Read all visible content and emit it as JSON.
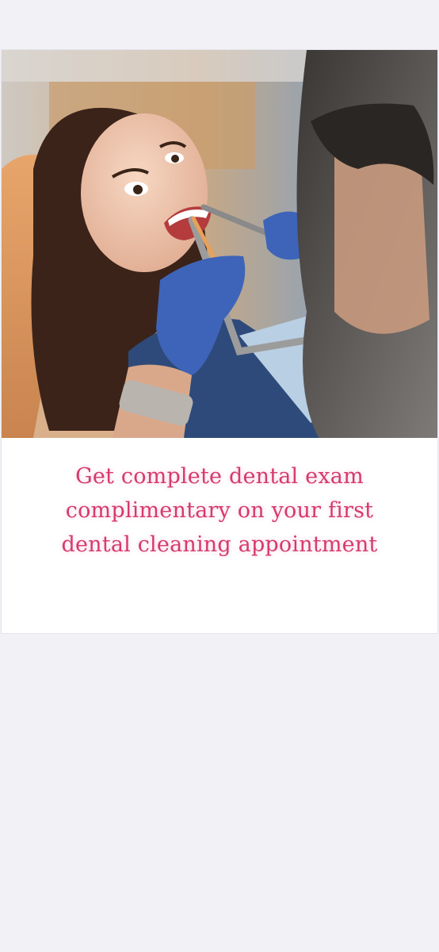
{
  "promo": {
    "image_subject": "dental-patient-photo",
    "caption_lines": [
      "Get complete dental exam",
      "complimentary on your first",
      "dental cleaning appointment"
    ]
  },
  "colors": {
    "page_background": "#f1f1f6",
    "card_background": "#ffffff",
    "caption_text": "#d63a6e"
  }
}
